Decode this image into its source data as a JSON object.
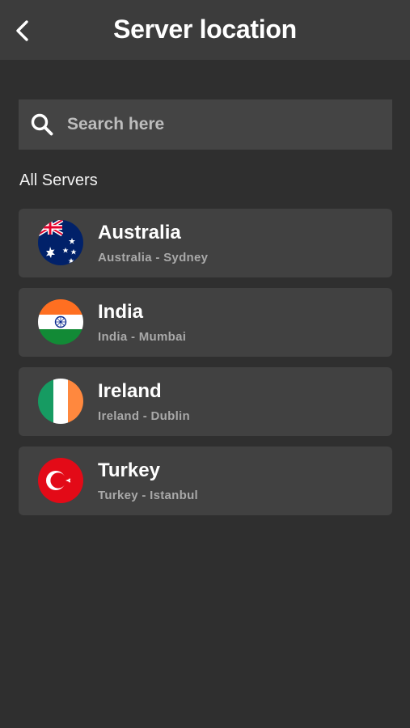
{
  "header": {
    "title": "Server location",
    "back_icon": "chevron-left-icon"
  },
  "search": {
    "placeholder": "Search here",
    "value": "",
    "icon": "search-icon"
  },
  "section": {
    "label": "All Servers"
  },
  "servers": [
    {
      "country": "Australia",
      "location": "Australia - Sydney",
      "flag": "australia-flag-icon"
    },
    {
      "country": "India",
      "location": "India - Mumbai",
      "flag": "india-flag-icon"
    },
    {
      "country": "Ireland",
      "location": "Ireland - Dublin",
      "flag": "ireland-flag-icon"
    },
    {
      "country": "Turkey",
      "location": "Turkey - Istanbul",
      "flag": "turkey-flag-icon"
    }
  ],
  "colors": {
    "background": "#2f2f2f",
    "header": "#3c3c3c",
    "card": "#414141",
    "search": "#444444",
    "subtext": "#a9a9a9"
  }
}
